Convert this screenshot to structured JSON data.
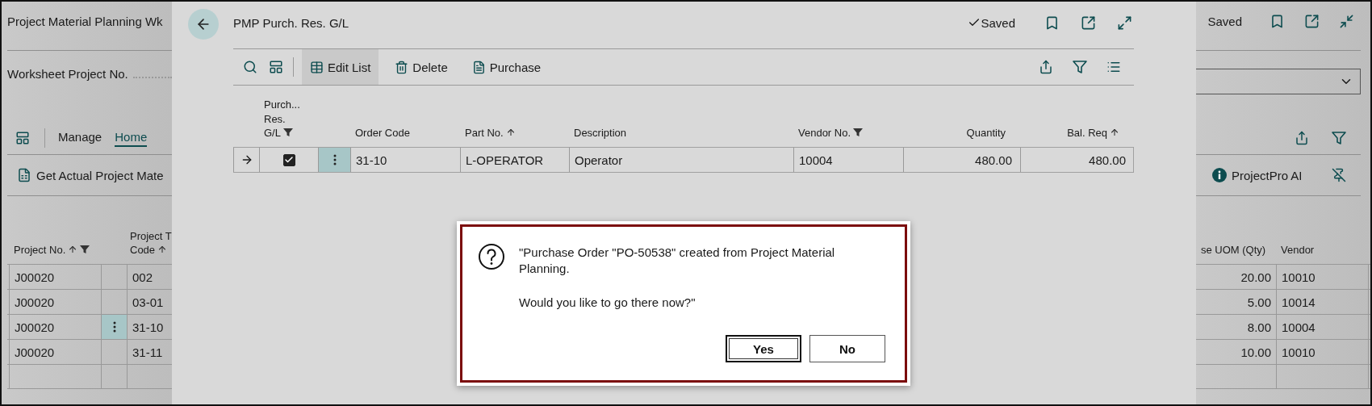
{
  "background_page": {
    "title": "Project Material Planning Wk",
    "saved": "Saved",
    "field_label": "Worksheet Project No.",
    "action_tabs": [
      {
        "label": "Manage",
        "selected": false
      },
      {
        "label": "Home",
        "selected": true
      }
    ],
    "action": "Get Actual Project Mate",
    "ai_button": "ProjectPro AI",
    "left_columns": [
      {
        "label": "Project No.",
        "sorted": true,
        "filtered": true
      },
      {
        "label": "Project T\nCode",
        "sorted": true,
        "filtered": false
      }
    ],
    "right_columns": [
      {
        "label": "se UOM (Qty)"
      },
      {
        "label": "Vendor"
      }
    ],
    "rows": [
      {
        "project_no": "J00020",
        "code": "002",
        "qty": "20.00",
        "vendor": "10010",
        "selected": false
      },
      {
        "project_no": "J00020",
        "code": "03-01",
        "qty": "5.00",
        "vendor": "10014",
        "selected": false
      },
      {
        "project_no": "J00020",
        "code": "31-10",
        "qty": "8.00",
        "vendor": "10004",
        "selected": true
      },
      {
        "project_no": "J00020",
        "code": "31-11",
        "qty": "10.00",
        "vendor": "10010",
        "selected": false
      }
    ]
  },
  "modal": {
    "title": "PMP Purch. Res. G/L",
    "saved": "Saved",
    "actions": [
      {
        "kind": "edit",
        "label": "Edit List",
        "selected": true
      },
      {
        "kind": "delete",
        "label": "Delete",
        "selected": false
      },
      {
        "kind": "purchase",
        "label": "Purchase",
        "selected": false
      }
    ],
    "checkbox_column": {
      "label": "Purch...\nRes.\nG/L",
      "filtered": true
    },
    "columns": [
      {
        "label": "Order Code",
        "sorted": false,
        "filtered": false
      },
      {
        "label": "Part No.",
        "sorted": true,
        "filtered": false
      },
      {
        "label": "Description",
        "sorted": false,
        "filtered": false
      },
      {
        "label": "Vendor No.",
        "sorted": false,
        "filtered": true
      },
      {
        "label": "Quantity",
        "sorted": false,
        "filtered": false
      },
      {
        "label": "Bal. Req",
        "sorted": true,
        "filtered": false
      }
    ],
    "rows": [
      {
        "current": true,
        "checked": true,
        "selected": true,
        "cells": [
          "31-10",
          "L-OPERATOR",
          "Operator",
          "10004",
          "480.00",
          "480.00"
        ]
      }
    ]
  },
  "dialog": {
    "message": [
      "\"Purchase Order \"PO-50538\" created from Project Material Planning.",
      "Would you like to go there now?\""
    ],
    "buttons": [
      {
        "label": "Yes",
        "focused": true
      },
      {
        "label": "No",
        "focused": false
      }
    ]
  }
}
